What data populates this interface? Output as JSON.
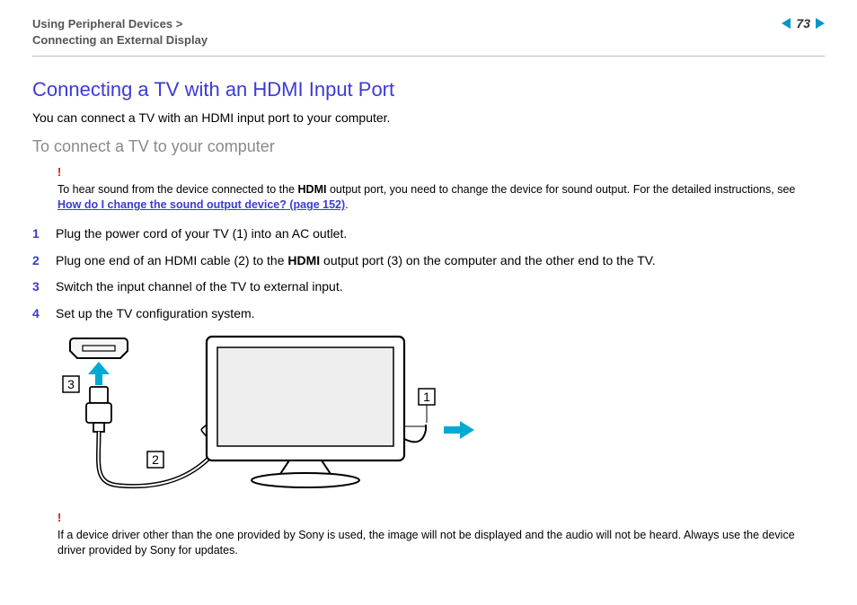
{
  "header": {
    "breadcrumb_top": "Using Peripheral Devices",
    "breadcrumb_sep": ">",
    "breadcrumb_bottom": "Connecting an External Display",
    "page_number": "73"
  },
  "title": "Connecting a TV with an HDMI Input Port",
  "intro": "You can connect a TV with an HDMI input port to your computer.",
  "subheading": "To connect a TV to your computer",
  "note1": {
    "bang": "!",
    "text_a": "To hear sound from the device connected to the ",
    "hdmi": "HDMI",
    "text_b": " output port, you need to change the device for sound output. For the detailed instructions, see ",
    "link_label": "How do I change the sound output device? (page 152)",
    "text_c": "."
  },
  "steps": [
    {
      "n": "1",
      "text": "Plug the power cord of your TV (1) into an AC outlet."
    },
    {
      "n": "2",
      "pre": "Plug one end of an HDMI cable (2) to the ",
      "bold": "HDMI",
      "post": " output port (3) on the computer and the other end to the TV."
    },
    {
      "n": "3",
      "text": "Switch the input channel of the TV to external input."
    },
    {
      "n": "4",
      "text": "Set up the TV configuration system."
    }
  ],
  "diagram": {
    "labels": {
      "l1": "1",
      "l2": "2",
      "l3": "3"
    }
  },
  "note2": {
    "bang": "!",
    "text": "If a device driver other than the one provided by Sony is used, the image will not be displayed and the audio will not be heard. Always use the device driver provided by Sony for updates."
  }
}
